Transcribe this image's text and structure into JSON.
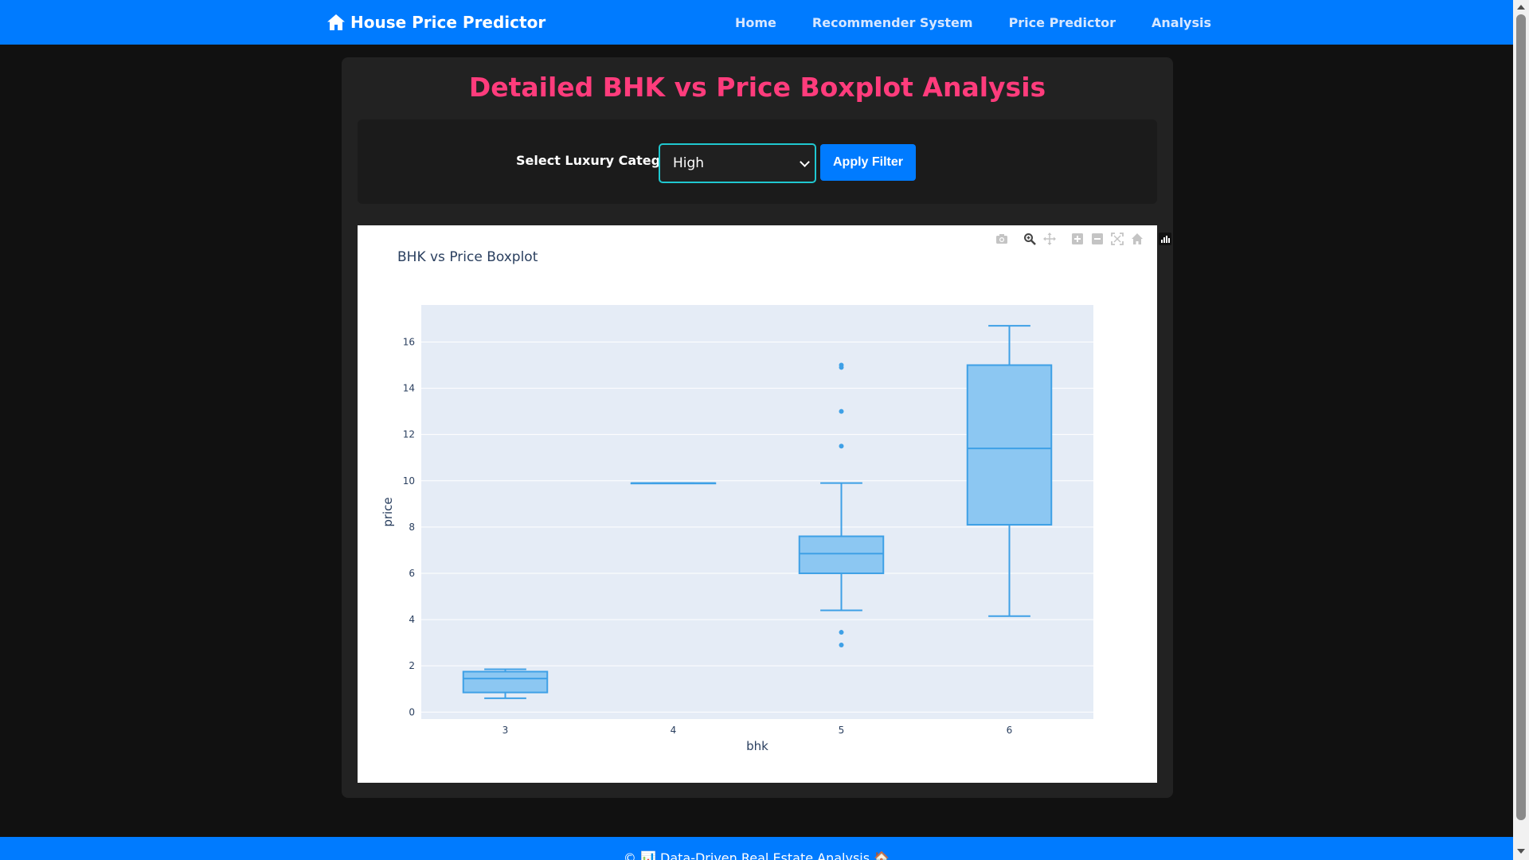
{
  "navbar": {
    "brand": "House Price Predictor",
    "links": [
      "Home",
      "Recommender System",
      "Price Predictor",
      "Analysis"
    ]
  },
  "page": {
    "title": "Detailed BHK vs Price Boxplot Analysis"
  },
  "filter": {
    "label": "Select Luxury Category:",
    "selected": "High",
    "button": "Apply Filter"
  },
  "colors": {
    "navbar": "#007bff",
    "title": "#ff3c7c",
    "box_fill": "#8cc7f2",
    "box_line": "#3ea0e6",
    "plot_bg": "#e5ecf6"
  },
  "modebar_icons": [
    "camera-icon",
    "zoom-icon",
    "pan-icon",
    "zoom-in-icon",
    "zoom-out-icon",
    "autoscale-icon",
    "reset-axes-icon",
    "plotly-logo-icon"
  ],
  "chart_data": {
    "type": "box",
    "title": "BHK vs Price Boxplot",
    "xlabel": "bhk",
    "ylabel": "price",
    "categories": [
      "3",
      "4",
      "5",
      "6"
    ],
    "yticks": [
      "0",
      "2",
      "4",
      "6",
      "8",
      "10",
      "12",
      "14",
      "16"
    ],
    "ylim": [
      -0.3,
      17.6
    ],
    "boxes": [
      {
        "x": "3",
        "lowerfence": 0.6,
        "q1": 0.85,
        "median": 1.45,
        "q3": 1.75,
        "upperfence": 1.85,
        "outliers": []
      },
      {
        "x": "4",
        "lowerfence": 9.9,
        "q1": 9.9,
        "median": 9.9,
        "q3": 9.9,
        "upperfence": 9.9,
        "outliers": []
      },
      {
        "x": "5",
        "lowerfence": 4.4,
        "q1": 6.0,
        "median": 6.85,
        "q3": 7.6,
        "upperfence": 9.9,
        "outliers": [
          2.9,
          3.45,
          11.5,
          13.0,
          14.9,
          15.0
        ]
      },
      {
        "x": "6",
        "lowerfence": 4.15,
        "q1": 8.1,
        "median": 11.4,
        "q3": 15.0,
        "upperfence": 16.7,
        "outliers": []
      }
    ],
    "grid": true,
    "legend": "none"
  },
  "footer": {
    "text": "© 📊 Data-Driven Real Estate Analysis 🏠"
  }
}
